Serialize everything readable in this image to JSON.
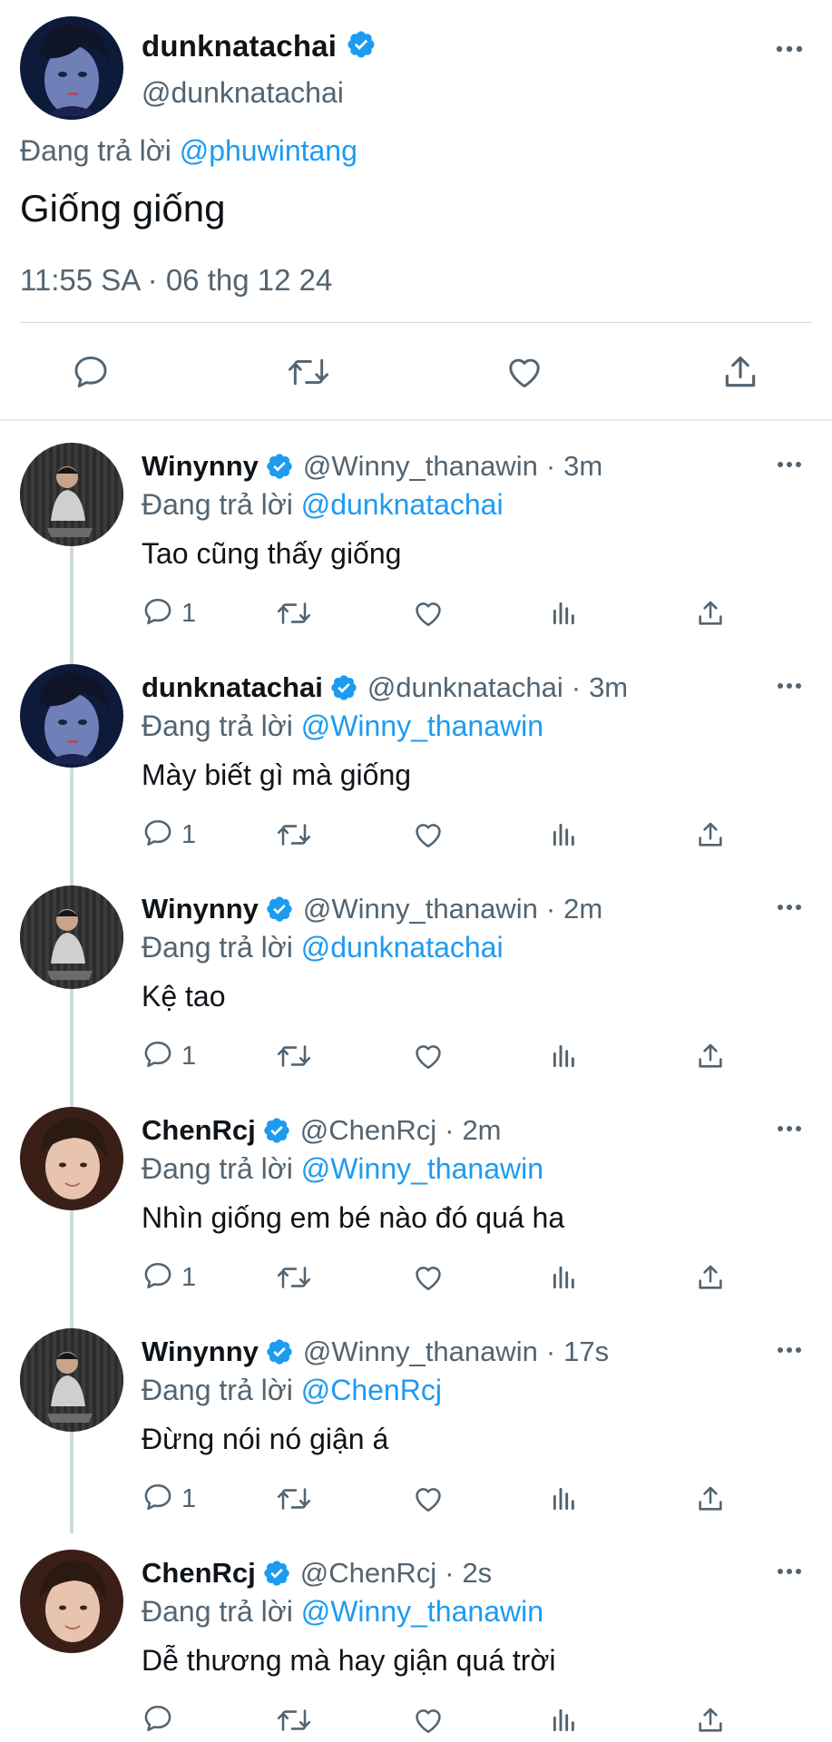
{
  "main_tweet": {
    "display_name": "dunknatachai",
    "handle": "@dunknatachai",
    "replying_prefix": "Đang trả lời",
    "replying_to": "@phuwintang",
    "text": "Giống giống",
    "timestamp": "11:55 SA · 06 thg 12 24",
    "actions": [
      "reply-icon",
      "retweet-icon",
      "like-icon",
      "share-icon"
    ]
  },
  "replies": [
    {
      "display_name": "Winynny",
      "handle": "@Winny_thanawin",
      "dot": "·",
      "time": "3m",
      "replying_prefix": "Đang trả lời",
      "replying_to": "@dunknatachai",
      "text": "Tao cũng thấy giống",
      "reply_count": "1"
    },
    {
      "display_name": "dunknatachai",
      "handle": "@dunknatachai",
      "dot": "·",
      "time": "3m",
      "replying_prefix": "Đang trả lời",
      "replying_to": "@Winny_thanawin",
      "text": "Mày biết gì mà giống",
      "reply_count": "1"
    },
    {
      "display_name": "Winynny",
      "handle": "@Winny_thanawin",
      "dot": "·",
      "time": "2m",
      "replying_prefix": "Đang trả lời",
      "replying_to": "@dunknatachai",
      "text": "Kệ tao",
      "reply_count": "1"
    },
    {
      "display_name": "ChenRcj",
      "handle": "@ChenRcj",
      "dot": "·",
      "time": "2m",
      "replying_prefix": "Đang trả lời",
      "replying_to": "@Winny_thanawin",
      "text": "Nhìn giống em bé nào đó quá ha",
      "reply_count": "1"
    },
    {
      "display_name": "Winynny",
      "handle": "@Winny_thanawin",
      "dot": "·",
      "time": "17s",
      "replying_prefix": "Đang trả lời",
      "replying_to": "@ChenRcj",
      "text": "Đừng nói nó giận á",
      "reply_count": "1"
    },
    {
      "display_name": "ChenRcj",
      "handle": "@ChenRcj",
      "dot": "·",
      "time": "2s",
      "replying_prefix": "Đang trả lời",
      "replying_to": "@Winny_thanawin",
      "text": "Dễ thương mà hay giận quá trời",
      "reply_count": ""
    }
  ],
  "colors": {
    "accent": "#1d9bf0",
    "secondary_text": "#536471",
    "primary_text": "#0f1419",
    "divider": "#cfd9de"
  }
}
